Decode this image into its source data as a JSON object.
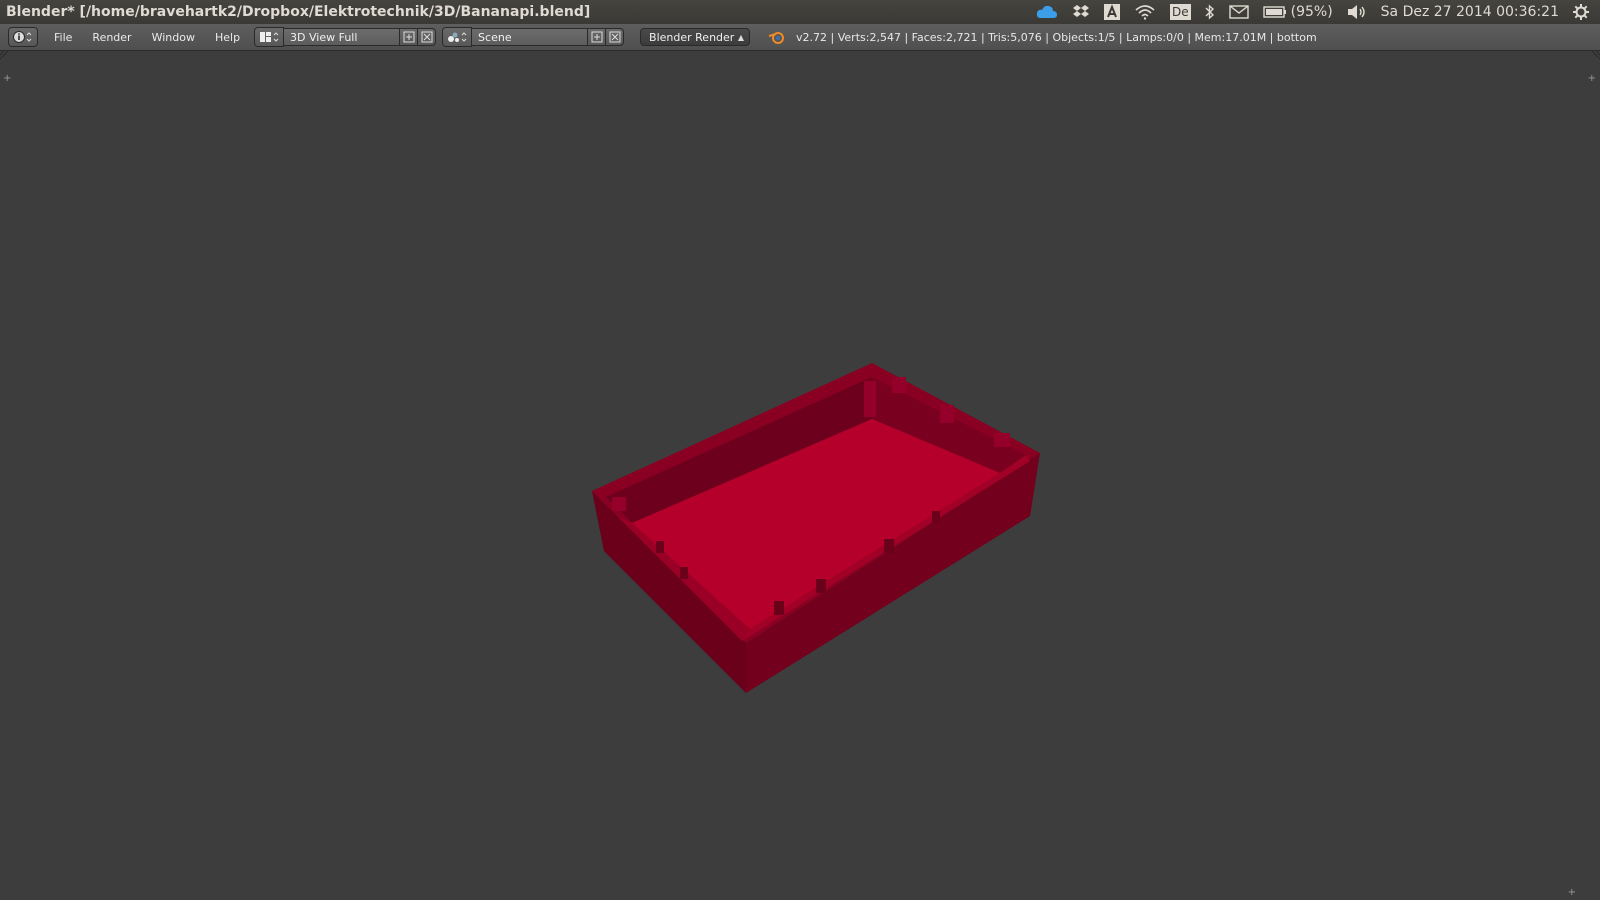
{
  "window": {
    "title": "Blender* [/home/bravehartk2/Dropbox/Elektrotechnik/3D/Bananapi.blend]"
  },
  "tray": {
    "battery_text": "(95%)",
    "clock": "Sa Dez 27 2014 00:36:21",
    "keyboard_layout": "De",
    "icons": [
      "cloud-icon",
      "dropbox-icon",
      "font-a-icon",
      "wifi-icon",
      "keyboard-layout-icon",
      "bluetooth-icon",
      "mail-icon",
      "battery-icon",
      "volume-icon",
      "settings-gear-icon"
    ]
  },
  "header": {
    "menus": [
      "File",
      "Render",
      "Window",
      "Help"
    ],
    "screen_layout": "3D View Full",
    "scene": "Scene",
    "render_engine": "Blender Render",
    "stats": "v2.72 | Verts:2,547 | Faces:2,721 | Tris:5,076 | Objects:1/5 | Lamps:0/0 | Mem:17.01M | bottom"
  },
  "colors": {
    "viewport_bg": "#3d3d3d",
    "model_top": "#b5002c",
    "model_inner_wall": "#7a0020",
    "model_outer_wall": "#6a001a"
  }
}
